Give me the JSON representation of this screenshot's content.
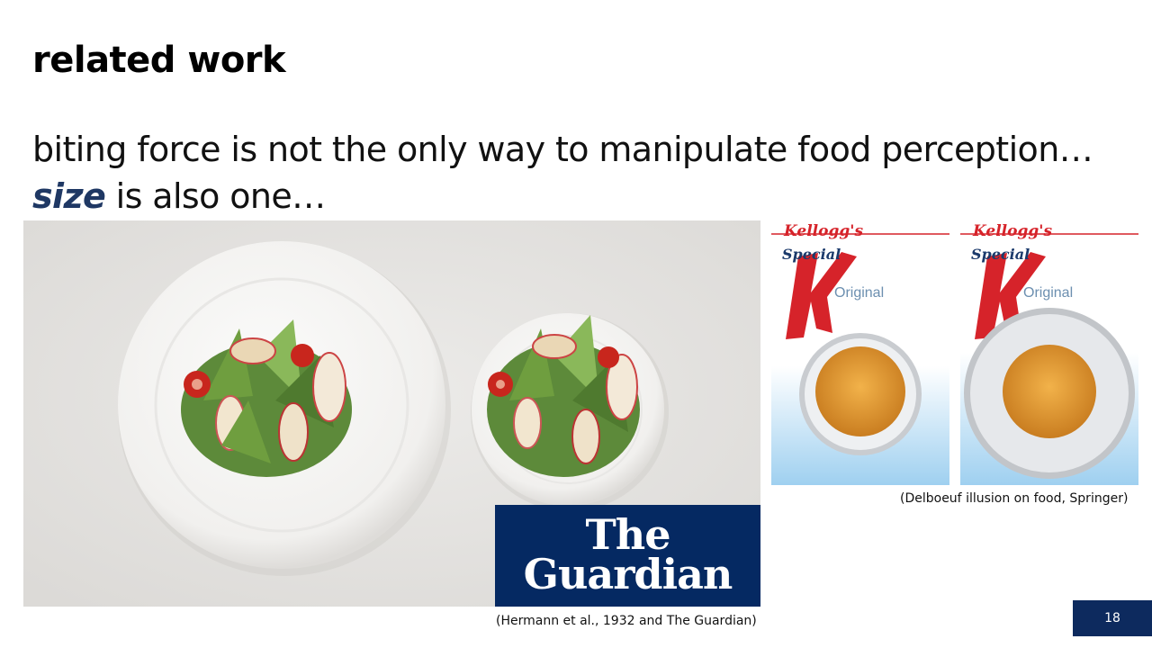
{
  "slide": {
    "title": "related work",
    "body_line1": "biting force is not the only way to manipulate food perception…",
    "body_emph": "size",
    "body_line2_rest": " is also one…",
    "page_number": "18"
  },
  "images": {
    "plates": {
      "logo_line1": "The",
      "logo_line2": "Guardian"
    },
    "cereal_boxes": [
      {
        "brand": "Kellogg's",
        "product": "Special",
        "letter": "K",
        "variant": "Original"
      },
      {
        "brand": "Kellogg's",
        "product": "Special",
        "letter": "K",
        "variant": "Original"
      }
    ]
  },
  "captions": {
    "right": "(Delboeuf illusion on food, Springer)",
    "left": "(Hermann et al., 1932 and The Guardian)"
  },
  "colors": {
    "emphasis": "#1f3864",
    "guardian_blue": "#052962",
    "page_badge": "#0d2a5e",
    "kelloggs_red": "#d6232a"
  }
}
